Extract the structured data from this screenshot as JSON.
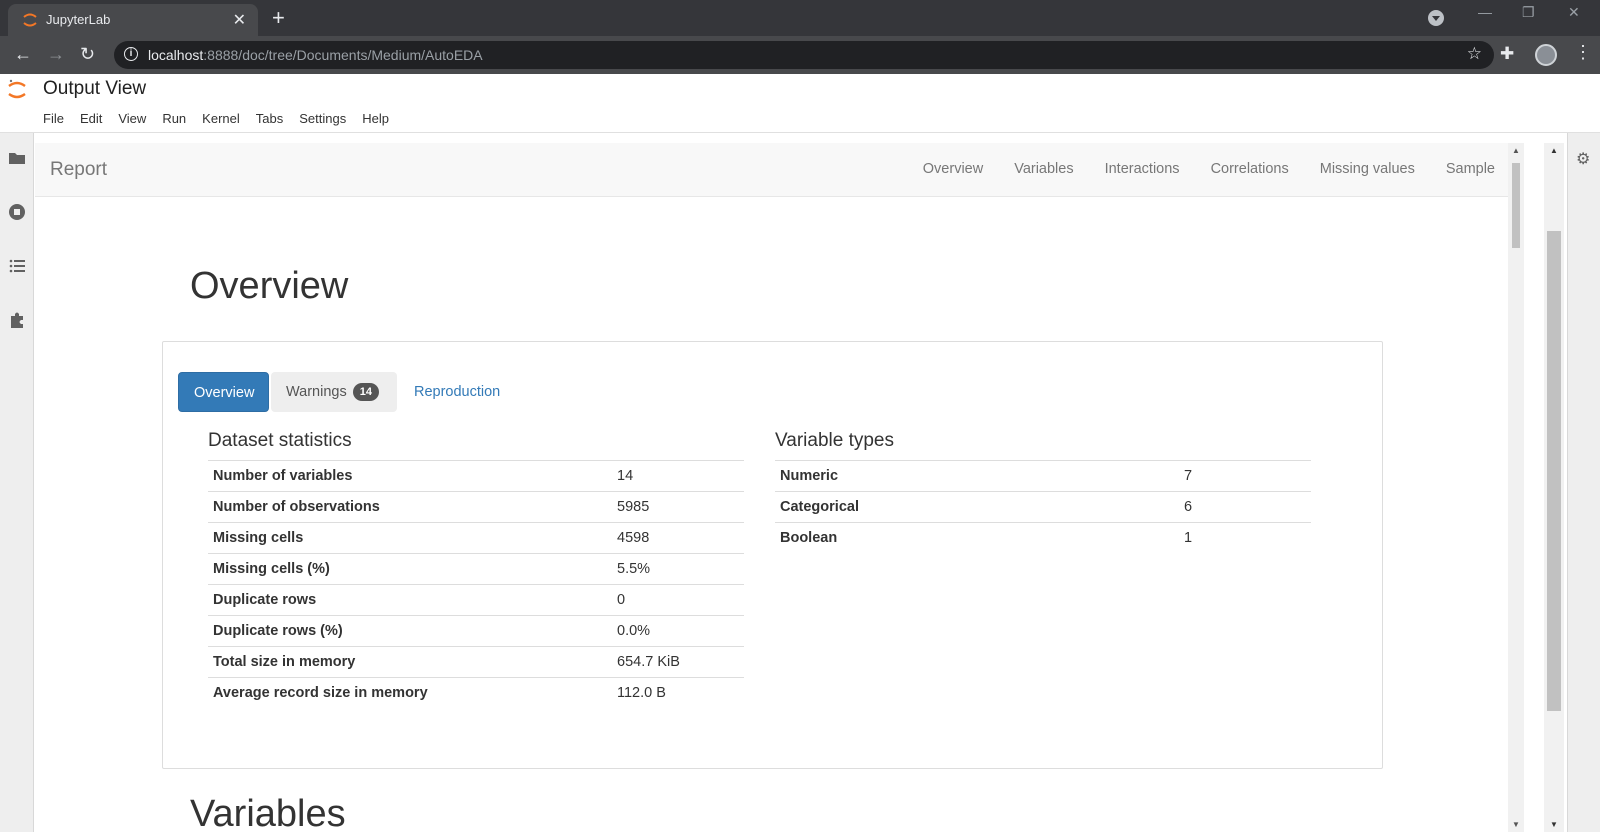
{
  "browser": {
    "tab_title": "JupyterLab",
    "url_host": "localhost",
    "url_rest": ":8888/doc/tree/Documents/Medium/AutoEDA"
  },
  "jupyter": {
    "title": "Output View",
    "menu": [
      "File",
      "Edit",
      "View",
      "Run",
      "Kernel",
      "Tabs",
      "Settings",
      "Help"
    ]
  },
  "report": {
    "brand": "Report",
    "nav": [
      "Overview",
      "Variables",
      "Interactions",
      "Correlations",
      "Missing values",
      "Sample"
    ],
    "section_title": "Overview",
    "tabs": {
      "overview": "Overview",
      "warnings": "Warnings",
      "warnings_count": "14",
      "reproduction": "Reproduction"
    },
    "dataset_statistics": {
      "title": "Dataset statistics",
      "rows": [
        {
          "label": "Number of variables",
          "value": "14"
        },
        {
          "label": "Number of observations",
          "value": "5985"
        },
        {
          "label": "Missing cells",
          "value": "4598"
        },
        {
          "label": "Missing cells (%)",
          "value": "5.5%"
        },
        {
          "label": "Duplicate rows",
          "value": "0"
        },
        {
          "label": "Duplicate rows (%)",
          "value": "0.0%"
        },
        {
          "label": "Total size in memory",
          "value": "654.7 KiB"
        },
        {
          "label": "Average record size in memory",
          "value": "112.0 B"
        }
      ]
    },
    "variable_types": {
      "title": "Variable types",
      "rows": [
        {
          "label": "Numeric",
          "value": "7"
        },
        {
          "label": "Categorical",
          "value": "6"
        },
        {
          "label": "Boolean",
          "value": "1"
        }
      ]
    },
    "next_section_title": "Variables"
  },
  "colors": {
    "accent": "#337ab7",
    "chrome_dark": "#35363a"
  }
}
